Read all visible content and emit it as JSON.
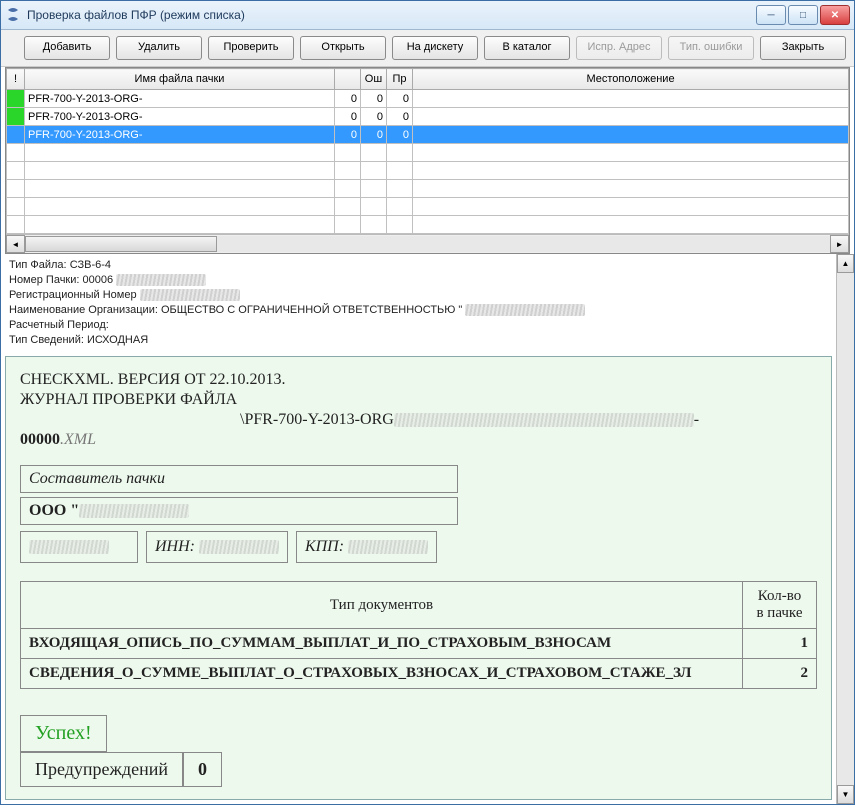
{
  "window": {
    "title": "Проверка файлов ПФР (режим списка)"
  },
  "toolbar": {
    "add": "Добавить",
    "delete": "Удалить",
    "check": "Проверить",
    "open": "Открыть",
    "to_floppy": "На дискету",
    "to_catalog": "В каталог",
    "fix_addr": "Испр. Адрес",
    "typ_err": "Тип. ошибки",
    "close": "Закрыть"
  },
  "grid": {
    "headers": {
      "flag": "!",
      "name": "Имя файла пачки",
      "err": "Ош",
      "pr": "Пр",
      "loc": "Местоположение"
    },
    "rows": [
      {
        "name": "PFR-700-Y-2013-ORG-",
        "n0": "0",
        "err": "0",
        "pr": "0",
        "sel": false
      },
      {
        "name": "PFR-700-Y-2013-ORG-",
        "n0": "0",
        "err": "0",
        "pr": "0",
        "sel": false
      },
      {
        "name": "PFR-700-Y-2013-ORG-",
        "n0": "0",
        "err": "0",
        "pr": "0",
        "sel": true
      }
    ]
  },
  "info": {
    "file_type_label": "Тип Файла:",
    "file_type": "СЗВ-6-4",
    "pack_no_label": "Номер Пачки:",
    "pack_no": "00006",
    "reg_no_label": "Регистрационный Номер",
    "org_label": "Наименование Организации:",
    "org_value": "ОБЩЕСТВО С ОГРАНИЧЕННОЙ ОТВЕТСТВЕННОСТЬЮ \"",
    "period_label": "Расчетный Период:",
    "type_sved_label": "Тип Сведений:",
    "type_sved": "ИСХОДНАЯ"
  },
  "report": {
    "header1": "CHECKXML. ВЕРСИЯ ОТ 22.10.2013.",
    "header2": "ЖУРНАЛ ПРОВЕРКИ ФАЙЛА",
    "path_prefix": "\\PFR-700-Y-2013-ORG",
    "path_suffix": "00000",
    "ext": ".XML",
    "compiler_label": "Составитель пачки",
    "ooo": "ООО \"",
    "inn_label": "ИНН:",
    "kpp_label": "КПП:",
    "doc_table": {
      "col1": "Тип документов",
      "col2_a": "Кол-во",
      "col2_b": "в пачке",
      "rows": [
        {
          "name": "ВХОДЯЩАЯ_ОПИСЬ_ПО_СУММАМ_ВЫПЛАТ_И_ПО_СТРАХОВЫМ_ВЗНОСАМ",
          "count": "1"
        },
        {
          "name": "СВЕДЕНИЯ_О_СУММЕ_ВЫПЛАТ_О_СТРАХОВЫХ_ВЗНОСАХ_И_СТРАХОВОМ_СТАЖЕ_ЗЛ",
          "count": "2"
        }
      ]
    },
    "success": "Успех!",
    "warn_label": "Предупреждений",
    "warn_count": "0"
  }
}
